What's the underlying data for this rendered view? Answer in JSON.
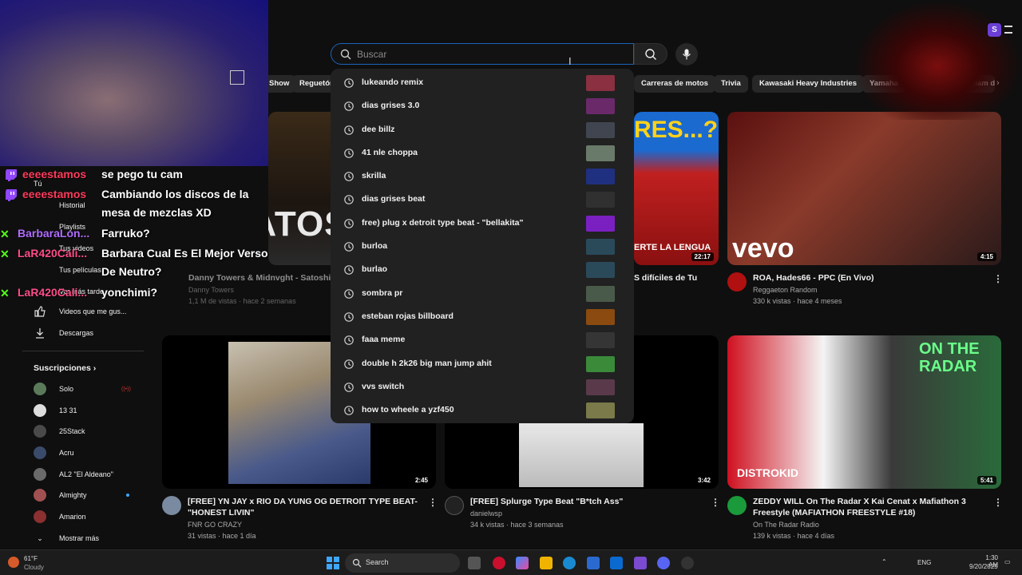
{
  "search": {
    "placeholder": "Buscar"
  },
  "chips": [
    {
      "label": "Show"
    },
    {
      "label": "Reguetón"
    },
    {
      "label": "Carreras de motos"
    },
    {
      "label": "Trivia"
    },
    {
      "label": "Kawasaki Heavy Industries"
    },
    {
      "label": "Yamaha"
    },
    {
      "label": "Slam d"
    }
  ],
  "suggestions": [
    {
      "text": "lukeando remix",
      "color": "#8a3040"
    },
    {
      "text": "dias grises 3.0",
      "color": "#6a2a6a"
    },
    {
      "text": "dee billz",
      "color": "#404550"
    },
    {
      "text": "41 nle choppa",
      "color": "#6a7a6a"
    },
    {
      "text": "skrilla",
      "color": "#203080"
    },
    {
      "text": "dias grises beat",
      "color": "#303030"
    },
    {
      "text": "free) plug x detroit type beat - \"bellakita\"",
      "color": "#7a20c0"
    },
    {
      "text": "burloa",
      "color": "#2a4a5a"
    },
    {
      "text": "burlao",
      "color": "#2a4a5a"
    },
    {
      "text": "sombra pr",
      "color": "#4a5a4a"
    },
    {
      "text": "esteban rojas billboard",
      "color": "#8a4a10"
    },
    {
      "text": "faaa meme",
      "color": "#353535"
    },
    {
      "text": "double h 2k26 big man jump ahit",
      "color": "#3a8a3a"
    },
    {
      "text": "vvs switch",
      "color": "#5a3a4a"
    },
    {
      "text": "how to wheele a yzf450",
      "color": "#7a7a4a"
    }
  ],
  "sidenav": {
    "items": [
      {
        "label": "Tú"
      },
      {
        "label": "Historial"
      },
      {
        "label": "Playlists"
      },
      {
        "label": "Tus videos"
      },
      {
        "label": "Tus películas"
      },
      {
        "label": "Ver más tarde"
      },
      {
        "label": "Videos que me gus..."
      },
      {
        "label": "Descargas"
      }
    ],
    "subs_title": "Suscripciones",
    "subs": [
      {
        "label": "Solo",
        "color": "#5a7a5a"
      },
      {
        "label": "13 31",
        "color": "#dddddd"
      },
      {
        "label": "25Stack",
        "color": "#4a4a4a"
      },
      {
        "label": "Acru",
        "color": "#3a4a6a"
      },
      {
        "label": "AL2 \"El Aldeano\"",
        "color": "#6a6a6a"
      },
      {
        "label": "Almighty",
        "color": "#a05050"
      },
      {
        "label": "Amarion",
        "color": "#8a3030"
      }
    ],
    "more": "Mostrar más"
  },
  "videos": [
    {
      "title": "Danny Towers & Midnvght - Satoshi (C",
      "channel": "Danny Towers",
      "meta": "1,1 M de vistas · hace 2 semanas",
      "overlay": "SATOS",
      "duration": ""
    },
    {
      "title": "S difíciles de Tu",
      "channel": "",
      "meta": "",
      "overlay": "RES...?",
      "caption": "ERTE LA LENGUA",
      "duration": "22:17"
    },
    {
      "title": "ROA, Hades66 - PPC (En Vivo)",
      "channel": "Reggaeton Random",
      "meta": "330 k vistas · hace 4 meses",
      "overlay": "vevo",
      "duration": "4:15"
    },
    {
      "title": "[FREE] YN JAY x  RIO DA YUNG OG DETROIT  TYPE BEAT- \"HONEST LIVIN\"",
      "channel": "FNR GO CRAZY",
      "meta": "31 vistas · hace 1 día",
      "duration": "2:45"
    },
    {
      "title": "[FREE] Splurge Type Beat \"B*tch Ass\"",
      "channel": "danielwsp",
      "meta": "34 k vistas · hace 3 semanas",
      "duration": "3:42"
    },
    {
      "title": "ZEDDY WILL On The Radar X Kai Cenat x Mafiathon 3 Freestyle (MAFIATHON FREESTYLE #18)",
      "channel": "On The Radar Radio",
      "meta": "139 k vistas · hace 4 días",
      "overlay": "DISTROKID",
      "badge": "ON THE RADAR",
      "duration": "5:41"
    }
  ],
  "chat": [
    {
      "user": "eeeestamos",
      "msg": "se pego tu cam",
      "color": "#ff3b5c",
      "badge": "twitch"
    },
    {
      "user": "eeeestamos",
      "msg": "Cambiando los discos de la mesa de mezclas XD",
      "color": "#ff3b5c",
      "badge": "twitch"
    },
    {
      "user": "BarbaraLon...",
      "msg": "Farruko?",
      "color": "#b06cff",
      "badge": "kick"
    },
    {
      "user": "LaR420Cali...",
      "msg": "Barbara Cual Es El Mejor Verso De Neutro?",
      "color": "#ff4d8a",
      "badge": "kick"
    },
    {
      "user": "LaR420Cali...",
      "msg": "yonchimi?",
      "color": "#ff4d8a",
      "badge": "kick"
    }
  ],
  "taskbar": {
    "weather_temp": "61°F",
    "weather_desc": "Cloudy",
    "search_label": "Search",
    "lang": "ENG",
    "time": "1:30 AM",
    "date": "9/20/2025"
  },
  "profile_initial": "S",
  "colors": {
    "accent": "#3ea6ff",
    "bg": "#0f0f0f",
    "search_border": "#1c62b9"
  }
}
